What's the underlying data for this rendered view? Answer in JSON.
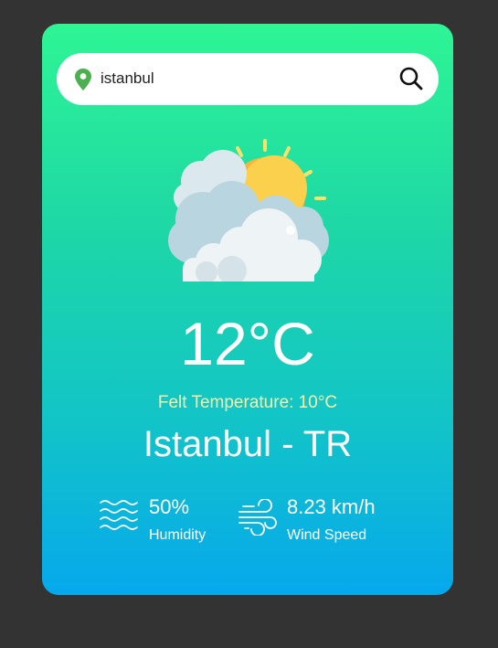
{
  "search": {
    "value": "istanbul",
    "icon_left": "location-pin-icon",
    "icon_right": "search-icon"
  },
  "weather": {
    "icon": "partly-cloudy-sun-icon",
    "temperature": "12°C",
    "felt_temperature": "Felt Temperature: 10°C",
    "location": "Istanbul - TR"
  },
  "stats": {
    "humidity": {
      "value": "50%",
      "label": "Humidity",
      "icon": "humidity-waves-icon"
    },
    "wind": {
      "value": "8.23 km/h",
      "label": "Wind Speed",
      "icon": "wind-icon"
    }
  },
  "colors": {
    "background": "#333333",
    "card_gradient_top": "#2ef595",
    "card_gradient_bottom": "#06a8ec",
    "felt_text": "#f7f2a9",
    "pin": "#4caf50"
  }
}
